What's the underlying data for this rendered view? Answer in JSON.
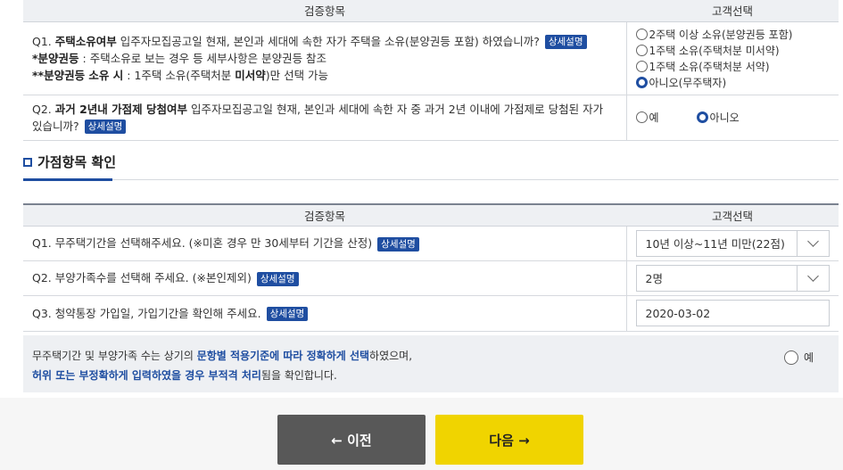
{
  "table1": {
    "header_item": "검증항목",
    "header_choice": "고객선택",
    "q1": {
      "num": "Q1.",
      "bold": "주택소유여부",
      "text": "입주자모집공고일 현재, 본인과 세대에 속한 자가 주택을 소유(분양권등 포함) 하였습니까?",
      "badge": "상세설명",
      "note1_bold": "*분양권등",
      "note1": " : 주택소유로 보는 경우 등 세부사항은 분양권등 참조",
      "note2_bold": "**분양권등 소유 시",
      "note2a": " : 1주택 소유(주택처분 ",
      "note2_bold2": "미서약",
      "note2b": ")만 선택 가능",
      "options": [
        "2주택 이상 소유(분양권등 포함)",
        "1주택 소유(주택처분 미서약)",
        "1주택 소유(주택처분 서약)",
        "아니오(무주택자)"
      ]
    },
    "q2": {
      "num": "Q2.",
      "bold": "과거 2년내 가점제 당첨여부",
      "text": "입주자모집공고일 현재, 본인과 세대에 속한 자 중 과거 2년 이내에 가점제로 당첨된 자가 있습니까?",
      "badge": "상세설명",
      "opt_yes": "예",
      "opt_no": "아니오"
    }
  },
  "section": {
    "title": "가점항목 확인"
  },
  "table2": {
    "header_item": "검증항목",
    "header_choice": "고객선택",
    "q1": {
      "text": "Q1. 무주택기간을 선택해주세요. (※미혼 경우 만 30세부터 기간을 산정)",
      "badge": "상세설명",
      "value": "10년 이상~11년 미만(22점)"
    },
    "q2": {
      "text": "Q2. 부양가족수를 선택해 주세요. (※본인제외)",
      "badge": "상세설명",
      "value": "2명"
    },
    "q3": {
      "text": "Q3. 청약통장 가입일, 가입기간을 확인해 주세요.",
      "badge": "상세설명",
      "value": "2020-03-02"
    }
  },
  "notice": {
    "l1a": "무주택기간 및 부양가족 수는 상기의 ",
    "l1b": "문항별 적용기준에 따라 정확하게 선택",
    "l1c": "하였으며,",
    "l2a": "허위 또는 부정확하게 입력하였을 경우 부적격 처리",
    "l2b": "됨을 확인합니다.",
    "agree": "예"
  },
  "buttons": {
    "prev": "← 이전",
    "next": "다음 →"
  },
  "colors": {
    "accent": "#1f4ea1",
    "next_button": "#f0d400",
    "prev_button": "#585858"
  }
}
